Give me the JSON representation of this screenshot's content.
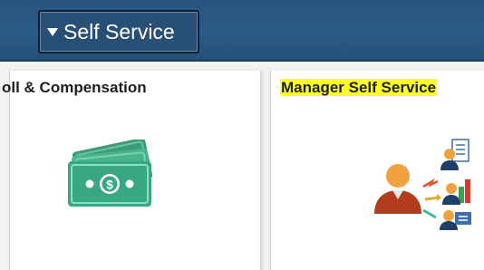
{
  "header": {
    "selector_label": "Self Service"
  },
  "tiles": [
    {
      "title": "oll & Compensation",
      "icon": "money-icon"
    },
    {
      "title": "Manager Self Service",
      "icon": "manager-people-icon",
      "highlight_color": "#ffff22"
    }
  ],
  "colors": {
    "header": "#2a5b86",
    "money_green": "#3aae86",
    "person_orange": "#f0a241",
    "person_red": "#b13c1e"
  }
}
